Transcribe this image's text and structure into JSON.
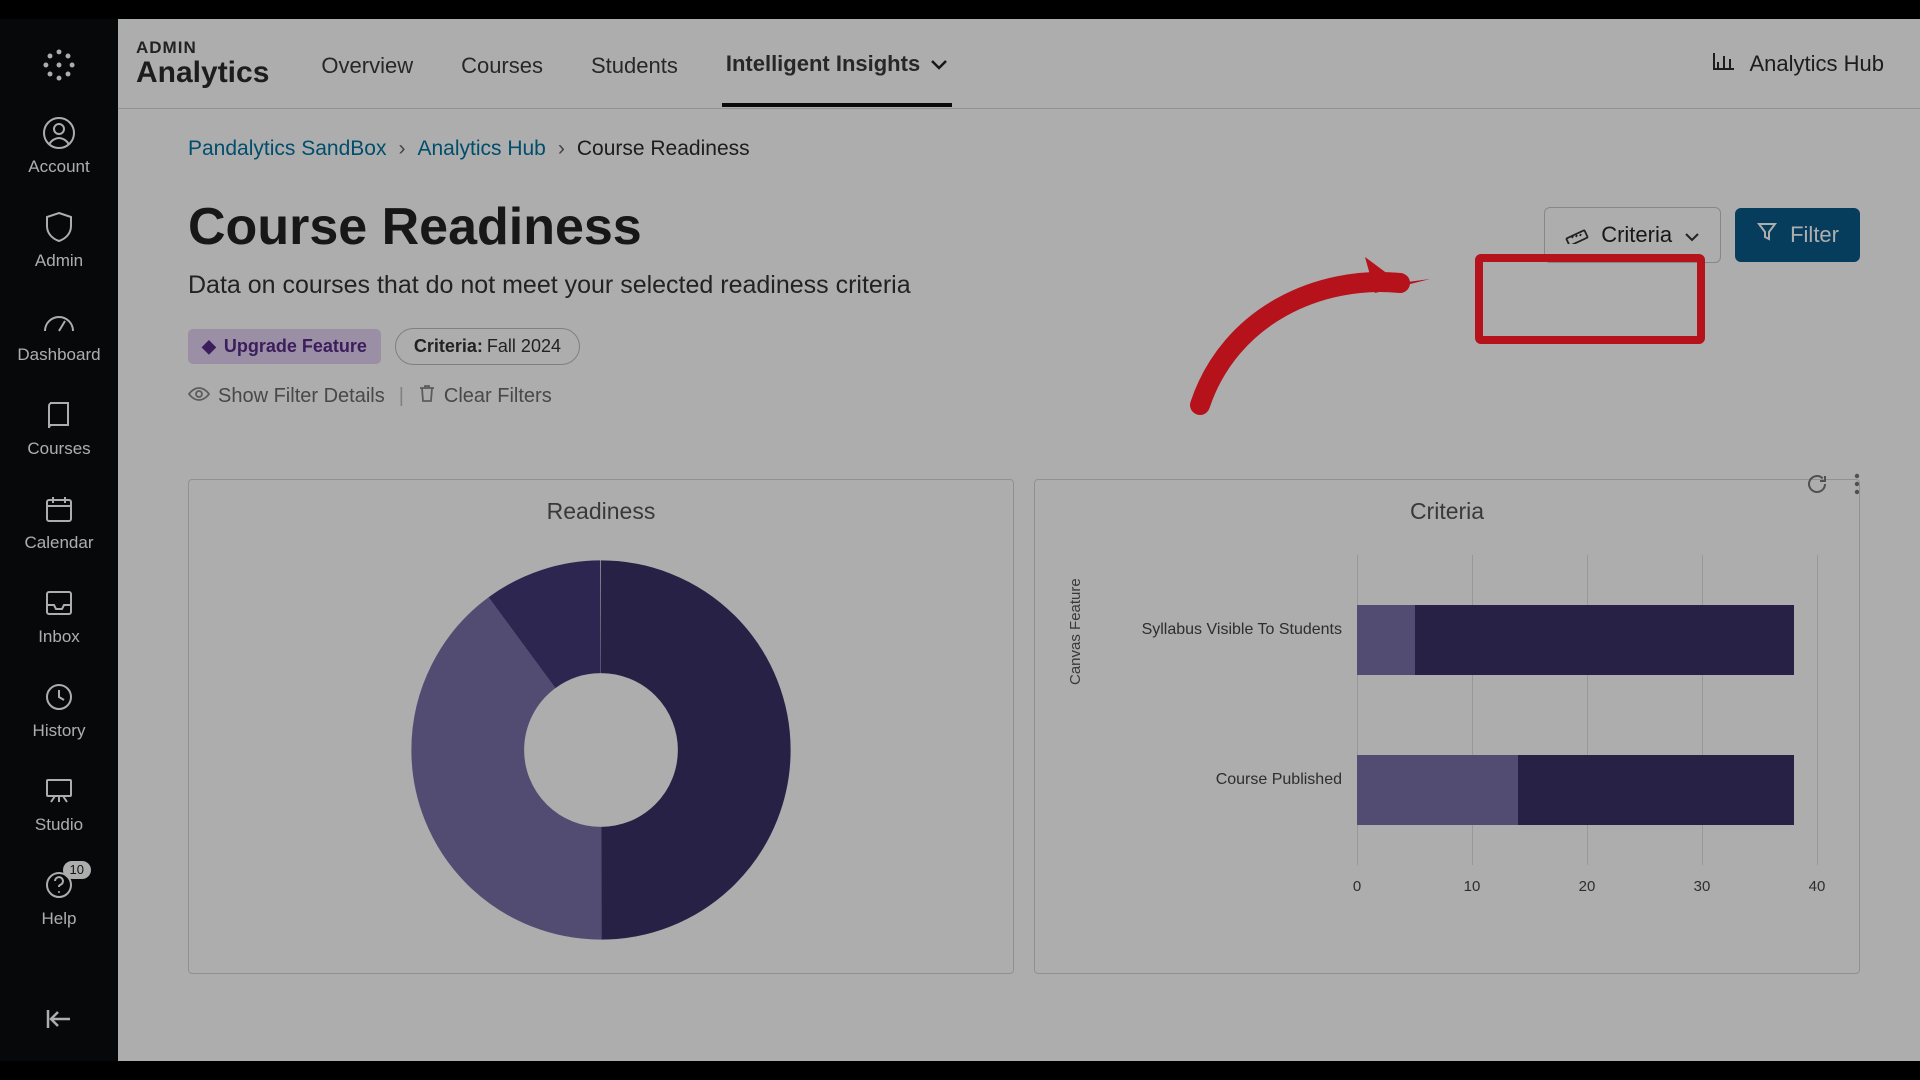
{
  "sidebar": {
    "items": [
      {
        "label": "Account"
      },
      {
        "label": "Admin"
      },
      {
        "label": "Dashboard"
      },
      {
        "label": "Courses"
      },
      {
        "label": "Calendar"
      },
      {
        "label": "Inbox"
      },
      {
        "label": "History"
      },
      {
        "label": "Studio"
      },
      {
        "label": "Help",
        "badge": "10"
      }
    ]
  },
  "brand": {
    "line1": "ADMIN",
    "line2": "Analytics"
  },
  "nav_tabs": {
    "items": [
      {
        "label": "Overview"
      },
      {
        "label": "Courses"
      },
      {
        "label": "Students"
      },
      {
        "label": "Intelligent Insights",
        "active": true
      }
    ]
  },
  "hub_link": {
    "label": "Analytics Hub"
  },
  "breadcrumbs": {
    "items": [
      {
        "label": "Pandalytics SandBox",
        "link": true
      },
      {
        "label": "Analytics Hub",
        "link": true
      },
      {
        "label": "Course Readiness",
        "link": false
      }
    ]
  },
  "page_title": "Course Readiness",
  "page_subtitle": "Data on courses that do not meet your selected readiness criteria",
  "actions": {
    "criteria_label": "Criteria",
    "filter_label": "Filter"
  },
  "tags": {
    "upgrade": "Upgrade Feature",
    "criteria_prefix": "Criteria:",
    "criteria_value": "Fall 2024"
  },
  "filter_links": {
    "show": "Show Filter Details",
    "clear": "Clear Filters"
  },
  "panels": {
    "readiness_title": "Readiness",
    "criteria_title": "Criteria"
  },
  "chart_data": [
    {
      "type": "pie",
      "title": "Readiness",
      "series": [
        {
          "name": "segment-dark-1",
          "value": 50,
          "color": "#3b3268"
        },
        {
          "name": "segment-light",
          "value": 40,
          "color": "#7b71a8"
        },
        {
          "name": "segment-dark-2",
          "value": 10,
          "color": "#423977"
        }
      ]
    },
    {
      "type": "bar",
      "title": "Criteria",
      "orientation": "horizontal",
      "ylabel": "Canvas Feature",
      "xlabel": "",
      "xlim": [
        0,
        40
      ],
      "x_ticks": [
        0,
        10,
        20,
        30,
        40
      ],
      "categories": [
        "Syllabus Visible To Students",
        "Course Published"
      ],
      "series": [
        {
          "name": "segment-a",
          "values": [
            5,
            14
          ],
          "color": "#7b71a8"
        },
        {
          "name": "segment-b",
          "values": [
            33,
            24
          ],
          "color": "#3b3268"
        }
      ]
    }
  ]
}
